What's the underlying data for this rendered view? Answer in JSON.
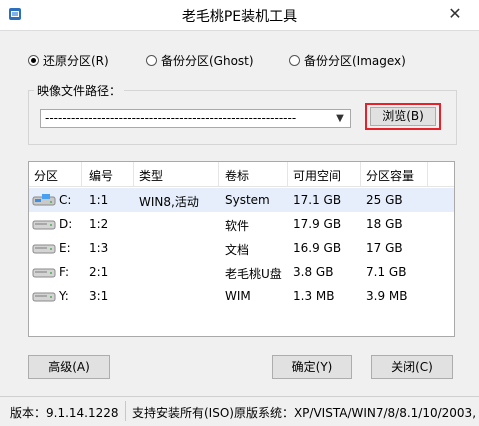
{
  "window": {
    "title": "老毛桃PE装机工具",
    "close_label": "✕"
  },
  "options": [
    {
      "label": "还原分区(R)",
      "selected": true
    },
    {
      "label": "备份分区(Ghost)",
      "selected": false
    },
    {
      "label": "备份分区(Imagex)",
      "selected": false
    }
  ],
  "image_path": {
    "group_label": "映像文件路径：",
    "value": "----------------------------------------------------------",
    "browse_label": "浏览(B)"
  },
  "table": {
    "columns": [
      "分区",
      "编号",
      "类型",
      "卷标",
      "可用空间",
      "分区容量"
    ],
    "rows": [
      {
        "drive": "C:",
        "num": "1:1",
        "type": "WIN8,活动",
        "label": "System",
        "free": "17.1 GB",
        "size": "25 GB",
        "system": true
      },
      {
        "drive": "D:",
        "num": "1:2",
        "type": "",
        "label": "软件",
        "free": "17.9 GB",
        "size": "18 GB",
        "system": false
      },
      {
        "drive": "E:",
        "num": "1:3",
        "type": "",
        "label": "文档",
        "free": "16.9 GB",
        "size": "17 GB",
        "system": false
      },
      {
        "drive": "F:",
        "num": "2:1",
        "type": "",
        "label": "老毛桃U盘",
        "free": "3.8 GB",
        "size": "7.1 GB",
        "system": false
      },
      {
        "drive": "Y:",
        "num": "3:1",
        "type": "",
        "label": "WIM",
        "free": "1.3 MB",
        "size": "3.9 MB",
        "system": false
      }
    ]
  },
  "buttons": {
    "advanced": "高级(A)",
    "ok": "确定(Y)",
    "close": "关闭(C)"
  },
  "status": {
    "version": "版本：9.1.14.1228",
    "support": "支持安装所有(ISO)原版系统：XP/VISTA/WIN7/8/8.1/10/2003,"
  },
  "colors": {
    "accent_border": "#e8202a",
    "selected_row": "#e5eefa"
  }
}
